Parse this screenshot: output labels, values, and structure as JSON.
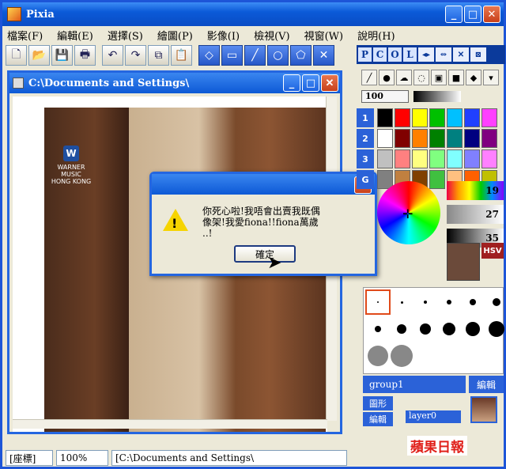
{
  "app": {
    "title": "Pixia"
  },
  "menu": [
    "檔案(F)",
    "編輯(E)",
    "選擇(S)",
    "繪圖(P)",
    "影像(I)",
    "檢視(V)",
    "視窗(W)",
    "說明(H)"
  ],
  "pcol": [
    "P",
    "C",
    "O",
    "L"
  ],
  "document": {
    "title": "C:\\Documents and Settings\\"
  },
  "photo_logo": {
    "line1": "WARNER MUSIC",
    "line2": "HONG KONG"
  },
  "dialog": {
    "message_line1": "你死心啦!我唔會出賣我既偶",
    "message_line2": "像架!我愛fiona!!fiona萬歲",
    "message_line3": "..!",
    "ok_label": "確定"
  },
  "panel": {
    "opacity": "100",
    "palette_rows": [
      "1",
      "2",
      "3",
      "G"
    ],
    "values": [
      "19",
      "27",
      "35"
    ],
    "hsv": "HSV",
    "group": "group1",
    "edit": "編輯",
    "figure_btn": "圖形",
    "edit_btn": "編輯",
    "layer": "layer0"
  },
  "status": {
    "mode": "[座標]",
    "zoom": "100%",
    "path": "[C:\\Documents and Settings\\"
  },
  "brand": "蘋果日報",
  "colors": {
    "titlebar": "#0b5ad8",
    "swatches": [
      "#000000",
      "#ff0000",
      "#ffff00",
      "#00c000",
      "#00c0ff",
      "#2040ff",
      "#ff40ff",
      "#ffffff",
      "#800000",
      "#ff8000",
      "#008000",
      "#008080",
      "#000080",
      "#800080",
      "#c0c0c0",
      "#ff8080",
      "#ffff80",
      "#80ff80",
      "#80ffff",
      "#8080ff",
      "#ff80ff",
      "#808080",
      "#c08040",
      "#804000",
      "#40c040",
      "#ffc080",
      "#ff6000",
      "#c0c000"
    ]
  }
}
